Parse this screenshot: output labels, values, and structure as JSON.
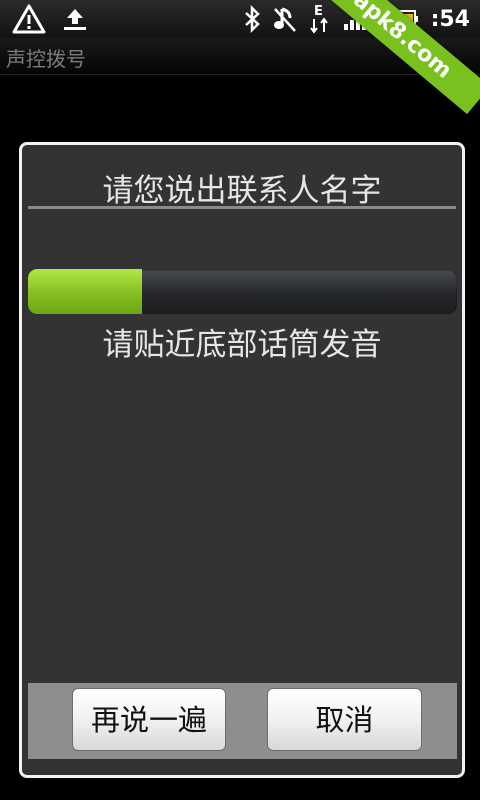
{
  "status_bar": {
    "time": ":54",
    "icons": [
      "warning-icon",
      "upload-icon",
      "bluetooth-icon",
      "no-sound-icon",
      "edge-data-icon",
      "signal-icon",
      "battery-icon"
    ],
    "edge_label": "E"
  },
  "watermark": {
    "text": "apk8.com",
    "color": "#79c11e"
  },
  "app": {
    "title": "声控拨号"
  },
  "dialog": {
    "title": "请您说出联系人名字",
    "progress": 0.265,
    "progress_color": "#8cc527",
    "hint": "请贴近底部话筒发音",
    "retry_label": "再说一遍",
    "cancel_label": "取消"
  }
}
